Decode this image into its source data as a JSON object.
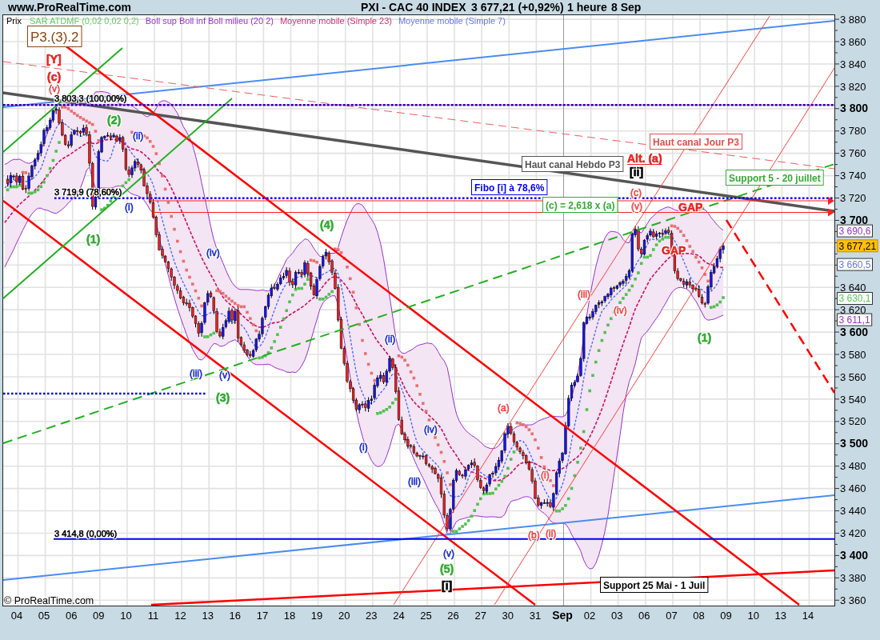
{
  "header": {
    "site": "www.ProRealTime.com",
    "instrument": "PXI - CAC 40 INDEX",
    "quote": "3 677,21 (+0,92%)",
    "interval": "1 heure",
    "date": "8 Sep"
  },
  "legend": [
    {
      "text": "Prix",
      "color": "#000000"
    },
    {
      "text": "SAR ATDMF (0,02 0,02 0,2)",
      "color": "#66cc66"
    },
    {
      "text": "Boll sup Boll inf Boll milieu (20 2)",
      "color": "#9933cc"
    },
    {
      "text": "Moyenne mobile (Simple 23)",
      "color": "#cc3377"
    },
    {
      "text": "Moyenne mobile (Simple 7)",
      "color": "#6677ee"
    }
  ],
  "chart": {
    "annotations": [
      {
        "text": "P3.(3).2",
        "kind": "title",
        "color": "#8b4513"
      },
      {
        "text": "[Y]",
        "kind": "major",
        "color": "#ee2222"
      },
      {
        "text": "(c)",
        "kind": "major",
        "color": "#ee2222"
      },
      {
        "text": "(v)",
        "kind": "minor",
        "color": "#f04848"
      },
      {
        "text": "3 803,3 (100,00%)",
        "kind": "level",
        "color": "#000000"
      },
      {
        "text": "(2)",
        "kind": "major",
        "color": "#33aa33"
      },
      {
        "text": "(ii)",
        "kind": "minor",
        "color": "#1a2ccc"
      },
      {
        "text": "Haut canal Jour P3",
        "kind": "boxed",
        "color": "#e05050"
      },
      {
        "text": "Haut canal Hebdo P3",
        "kind": "boxed",
        "color": "#555555"
      },
      {
        "text": "Alt. (a)",
        "kind": "underlined",
        "color": "#ee2222"
      },
      {
        "text": "[ii]",
        "kind": "major",
        "color": "#000000"
      },
      {
        "text": "3 719,9 (78,60%)",
        "kind": "level",
        "color": "#000000"
      },
      {
        "text": "Fibo [i] à 78,6%",
        "kind": "boxed",
        "color": "#0000ee"
      },
      {
        "text": "Support 5 - 20 juillet",
        "kind": "boxed",
        "color": "#33aa33"
      },
      {
        "text": "(i)",
        "kind": "minor",
        "color": "#1a2ccc"
      },
      {
        "text": "(c) = 2,618 x (a)",
        "kind": "boxed",
        "color": "#33aa33"
      },
      {
        "text": "(c)",
        "kind": "minor",
        "color": "#f04848"
      },
      {
        "text": "(v)",
        "kind": "minor",
        "color": "#f04848"
      },
      {
        "text": "GAP",
        "kind": "major",
        "color": "#ee2222"
      },
      {
        "text": "(4)",
        "kind": "major",
        "color": "#33aa33"
      },
      {
        "text": "(1)",
        "kind": "major",
        "color": "#33aa33"
      },
      {
        "text": "(iv)",
        "kind": "minor",
        "color": "#1a2ccc"
      },
      {
        "text": "GAP",
        "kind": "major",
        "color": "#ee2222"
      },
      {
        "text": "(iii)",
        "kind": "minor",
        "color": "#f04848"
      },
      {
        "text": "(iv)",
        "kind": "minor",
        "color": "#f04848"
      },
      {
        "text": "(ii)",
        "kind": "minor",
        "color": "#1a2ccc"
      },
      {
        "text": "(1)",
        "kind": "major",
        "color": "#33aa33"
      },
      {
        "text": "(iii)",
        "kind": "minor",
        "color": "#1a2ccc"
      },
      {
        "text": "(v)",
        "kind": "minor",
        "color": "#1a2ccc"
      },
      {
        "text": "(3)",
        "kind": "major",
        "color": "#33aa33"
      },
      {
        "text": "(a)",
        "kind": "minor",
        "color": "#f04848"
      },
      {
        "text": "(iv)",
        "kind": "minor",
        "color": "#1a2ccc"
      },
      {
        "text": "(i)",
        "kind": "minor",
        "color": "#1a2ccc"
      },
      {
        "text": "(iii)",
        "kind": "minor",
        "color": "#1a2ccc"
      },
      {
        "text": "(i)",
        "kind": "minor",
        "color": "#f04848"
      },
      {
        "text": "3 414,8 (0,00%)",
        "kind": "level",
        "color": "#000000"
      },
      {
        "text": "(b)",
        "kind": "minor",
        "color": "#f04848"
      },
      {
        "text": "(ii)",
        "kind": "minor",
        "color": "#f04848"
      },
      {
        "text": "(v)",
        "kind": "minor",
        "color": "#1a2ccc"
      },
      {
        "text": "(5)",
        "kind": "major",
        "color": "#33aa33"
      },
      {
        "text": "[i]",
        "kind": "major",
        "color": "#000000"
      },
      {
        "text": "Support 25 Mai - 1 Juil",
        "kind": "boxed",
        "color": "#000000"
      }
    ],
    "copyright": "© ProRealTime.com"
  },
  "price_axis": [
    {
      "label": "3 880",
      "kind": "minor"
    },
    {
      "label": "3 860",
      "kind": "minor"
    },
    {
      "label": "3 840",
      "kind": "minor"
    },
    {
      "label": "3 820",
      "kind": "minor"
    },
    {
      "label": "3 800",
      "kind": "major"
    },
    {
      "label": "3 780",
      "kind": "minor"
    },
    {
      "label": "3 760",
      "kind": "minor"
    },
    {
      "label": "3 740",
      "kind": "minor"
    },
    {
      "label": "3 720",
      "kind": "minor"
    },
    {
      "label": "3 700",
      "kind": "major"
    },
    {
      "label": "3 640",
      "kind": "minor"
    },
    {
      "label": "3 620",
      "kind": "minor"
    },
    {
      "label": "3 600",
      "kind": "major"
    },
    {
      "label": "3 580",
      "kind": "minor"
    },
    {
      "label": "3 560",
      "kind": "minor"
    },
    {
      "label": "3 540",
      "kind": "minor"
    },
    {
      "label": "3 520",
      "kind": "minor"
    },
    {
      "label": "3 500",
      "kind": "major"
    },
    {
      "label": "3 480",
      "kind": "minor"
    },
    {
      "label": "3 460",
      "kind": "minor"
    },
    {
      "label": "3 440",
      "kind": "minor"
    },
    {
      "label": "3 420",
      "kind": "minor"
    },
    {
      "label": "3 400",
      "kind": "major"
    },
    {
      "label": "3 380",
      "kind": "minor"
    },
    {
      "label": "3 360",
      "kind": "minor"
    }
  ],
  "price_tags": [
    {
      "text": "3 690,6",
      "kind": "outlined",
      "color": "#9933cc"
    },
    {
      "text": "3 677,21",
      "kind": "filled",
      "color": "#ffc000"
    },
    {
      "text": "3 660,5",
      "kind": "outlined",
      "color": "#6677ee"
    },
    {
      "text": "3 630,1",
      "kind": "outlined",
      "color": "#55cc55"
    },
    {
      "text": "3 611,1",
      "kind": "outlined",
      "color": "#9933cc"
    }
  ],
  "date_axis": [
    {
      "text": "04",
      "kind": "day"
    },
    {
      "text": "05",
      "kind": "day"
    },
    {
      "text": "06",
      "kind": "day"
    },
    {
      "text": "09",
      "kind": "day"
    },
    {
      "text": "10",
      "kind": "day"
    },
    {
      "text": "11",
      "kind": "day"
    },
    {
      "text": "12",
      "kind": "day"
    },
    {
      "text": "13",
      "kind": "day"
    },
    {
      "text": "16",
      "kind": "day"
    },
    {
      "text": "17",
      "kind": "day"
    },
    {
      "text": "18",
      "kind": "day"
    },
    {
      "text": "19",
      "kind": "day"
    },
    {
      "text": "20",
      "kind": "day"
    },
    {
      "text": "23",
      "kind": "day"
    },
    {
      "text": "24",
      "kind": "day"
    },
    {
      "text": "25",
      "kind": "day"
    },
    {
      "text": "26",
      "kind": "day"
    },
    {
      "text": "27",
      "kind": "day"
    },
    {
      "text": "30",
      "kind": "day"
    },
    {
      "text": "31",
      "kind": "day"
    },
    {
      "text": "Sep",
      "kind": "month"
    },
    {
      "text": "02",
      "kind": "day"
    },
    {
      "text": "03",
      "kind": "day"
    },
    {
      "text": "06",
      "kind": "day"
    },
    {
      "text": "07",
      "kind": "day"
    },
    {
      "text": "08",
      "kind": "day"
    },
    {
      "text": "09",
      "kind": "day"
    },
    {
      "text": "10",
      "kind": "day"
    },
    {
      "text": "13",
      "kind": "day"
    },
    {
      "text": "14",
      "kind": "day"
    }
  ]
}
